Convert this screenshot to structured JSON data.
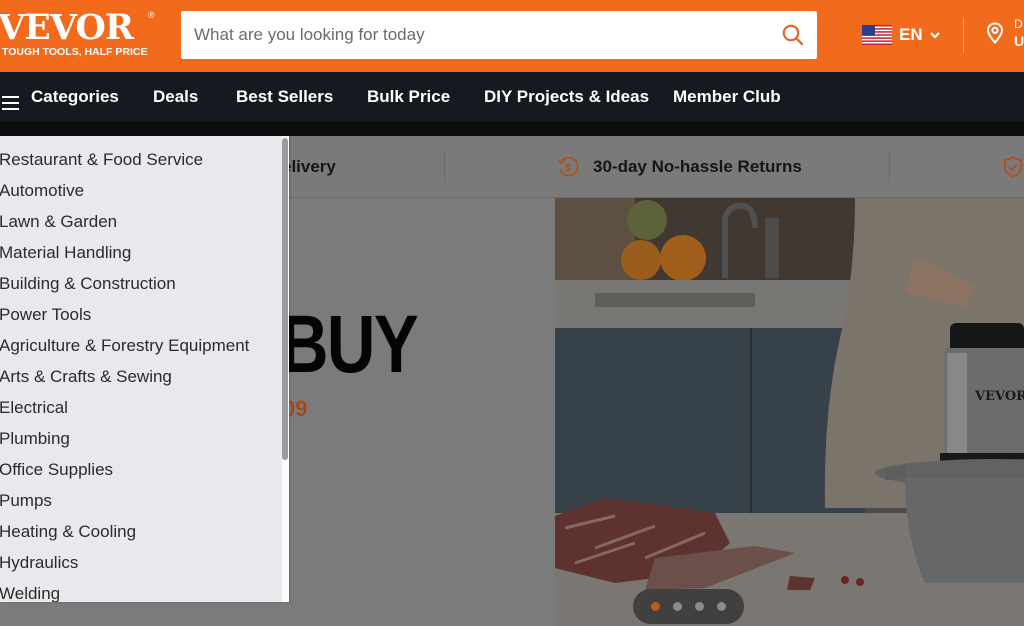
{
  "header": {
    "logo_text": "VEVOR",
    "logo_registered": "®",
    "logo_tagline": "TOUGH TOOLS, HALF PRICE",
    "search_placeholder": "What are you looking for today",
    "search_value": "",
    "language": "EN",
    "location_line1": "D",
    "location_line2": "U",
    "brand_color": "#f26b1d"
  },
  "nav": {
    "categories_label": "Categories",
    "items": [
      {
        "label": "Deals"
      },
      {
        "label": "Best Sellers"
      },
      {
        "label": "Bulk Price"
      },
      {
        "label": "DIY Projects & Ideas"
      },
      {
        "label": "Member Club"
      }
    ]
  },
  "trust_bar": {
    "items": [
      {
        "label": "elivery"
      },
      {
        "label": "30-day No-hassle Returns",
        "icon": "dollar-return-icon"
      },
      {
        "label": "",
        "icon": "shield-check-icon"
      }
    ]
  },
  "hero": {
    "headline_partial": "BUY",
    "price_partial": "09",
    "product_brand": "VEVOR",
    "carousel": {
      "total": 4,
      "active_index": 0
    }
  },
  "categories_menu": {
    "items": [
      {
        "label": "Restaurant & Food Service"
      },
      {
        "label": "Automotive"
      },
      {
        "label": "Lawn & Garden"
      },
      {
        "label": "Material Handling"
      },
      {
        "label": "Building & Construction"
      },
      {
        "label": "Power Tools"
      },
      {
        "label": "Agriculture & Forestry Equipment"
      },
      {
        "label": "Arts & Crafts & Sewing"
      },
      {
        "label": "Electrical"
      },
      {
        "label": "Plumbing"
      },
      {
        "label": "Office Supplies"
      },
      {
        "label": "Pumps"
      },
      {
        "label": "Heating & Cooling"
      },
      {
        "label": "Hydraulics"
      },
      {
        "label": "Welding"
      }
    ]
  }
}
